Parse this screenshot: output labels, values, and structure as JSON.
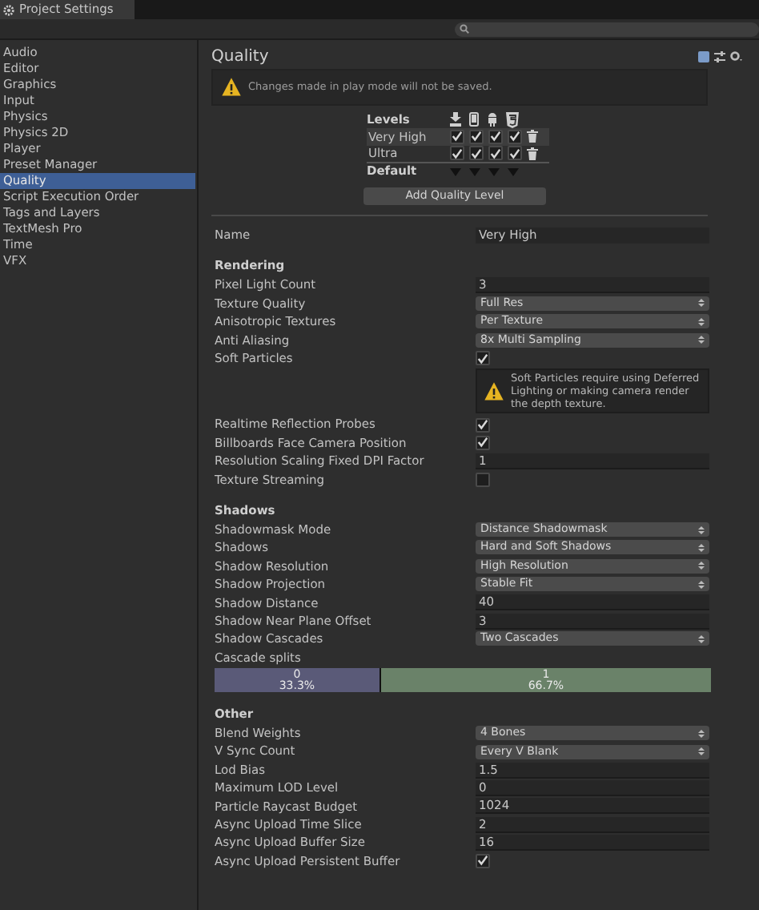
{
  "window": {
    "tab": "Project Settings"
  },
  "sidebar": {
    "items": [
      {
        "label": "Audio",
        "selected": false
      },
      {
        "label": "Editor",
        "selected": false
      },
      {
        "label": "Graphics",
        "selected": false
      },
      {
        "label": "Input",
        "selected": false
      },
      {
        "label": "Physics",
        "selected": false
      },
      {
        "label": "Physics 2D",
        "selected": false
      },
      {
        "label": "Player",
        "selected": false
      },
      {
        "label": "Preset Manager",
        "selected": false
      },
      {
        "label": "Quality",
        "selected": true
      },
      {
        "label": "Script Execution Order",
        "selected": false
      },
      {
        "label": "Tags and Layers",
        "selected": false
      },
      {
        "label": "TextMesh Pro",
        "selected": false
      },
      {
        "label": "Time",
        "selected": false
      },
      {
        "label": "VFX",
        "selected": false
      }
    ]
  },
  "header": {
    "title": "Quality"
  },
  "play_mode_warning": "Changes made in play mode will not be saved.",
  "levels": {
    "title": "Levels",
    "rows": [
      {
        "name": "Very High",
        "selected": true,
        "platforms": [
          true,
          true,
          true,
          true
        ]
      },
      {
        "name": "Ultra",
        "selected": false,
        "platforms": [
          true,
          true,
          true,
          true
        ]
      }
    ],
    "default_label": "Default"
  },
  "add_button": "Add Quality Level",
  "name_field": {
    "label": "Name",
    "value": "Very High"
  },
  "sections": [
    {
      "title": "Rendering",
      "fields": [
        {
          "kind": "text",
          "label": "Pixel Light Count",
          "value": "3"
        },
        {
          "kind": "dropdown",
          "label": "Texture Quality",
          "value": "Full Res"
        },
        {
          "kind": "dropdown",
          "label": "Anisotropic Textures",
          "value": "Per Texture"
        },
        {
          "kind": "dropdown",
          "label": "Anti Aliasing",
          "value": "8x Multi Sampling"
        },
        {
          "kind": "checkbox",
          "label": "Soft Particles",
          "checked": true
        },
        {
          "kind": "warning",
          "text": "Soft Particles require using Deferred Lighting or making camera render the depth texture."
        },
        {
          "kind": "checkbox",
          "label": "Realtime Reflection Probes",
          "checked": true
        },
        {
          "kind": "checkbox",
          "label": "Billboards Face Camera Position",
          "checked": true
        },
        {
          "kind": "text",
          "label": "Resolution Scaling Fixed DPI Factor",
          "value": "1"
        },
        {
          "kind": "checkbox",
          "label": "Texture Streaming",
          "checked": false
        }
      ]
    },
    {
      "title": "Shadows",
      "fields": [
        {
          "kind": "dropdown",
          "label": "Shadowmask Mode",
          "value": "Distance Shadowmask"
        },
        {
          "kind": "dropdown",
          "label": "Shadows",
          "value": "Hard and Soft Shadows"
        },
        {
          "kind": "dropdown",
          "label": "Shadow Resolution",
          "value": "High Resolution"
        },
        {
          "kind": "dropdown",
          "label": "Shadow Projection",
          "value": "Stable Fit"
        },
        {
          "kind": "text",
          "label": "Shadow Distance",
          "value": "40"
        },
        {
          "kind": "text",
          "label": "Shadow Near Plane Offset",
          "value": "3"
        },
        {
          "kind": "dropdown",
          "label": "Shadow Cascades",
          "value": "Two Cascades"
        },
        {
          "kind": "splits",
          "label": "Cascade splits",
          "splits": [
            {
              "index": "0",
              "percent": "33.3%",
              "level": 0.333,
              "color": "#5a5a78"
            },
            {
              "index": "1",
              "percent": "66.7%",
              "level": 0.667,
              "color": "#6a8269"
            }
          ]
        }
      ]
    },
    {
      "title": "Other",
      "fields": [
        {
          "kind": "dropdown",
          "label": "Blend Weights",
          "value": "4 Bones"
        },
        {
          "kind": "dropdown",
          "label": "V Sync Count",
          "value": "Every V Blank"
        },
        {
          "kind": "text",
          "label": "Lod Bias",
          "value": "1.5"
        },
        {
          "kind": "text",
          "label": "Maximum LOD Level",
          "value": "0"
        },
        {
          "kind": "text",
          "label": "Particle Raycast Budget",
          "value": "1024"
        },
        {
          "kind": "text",
          "label": "Async Upload Time Slice",
          "value": "2"
        },
        {
          "kind": "text",
          "label": "Async Upload Buffer Size",
          "value": "16"
        },
        {
          "kind": "checkbox",
          "label": "Async Upload Persistent Buffer",
          "checked": true
        }
      ]
    }
  ]
}
